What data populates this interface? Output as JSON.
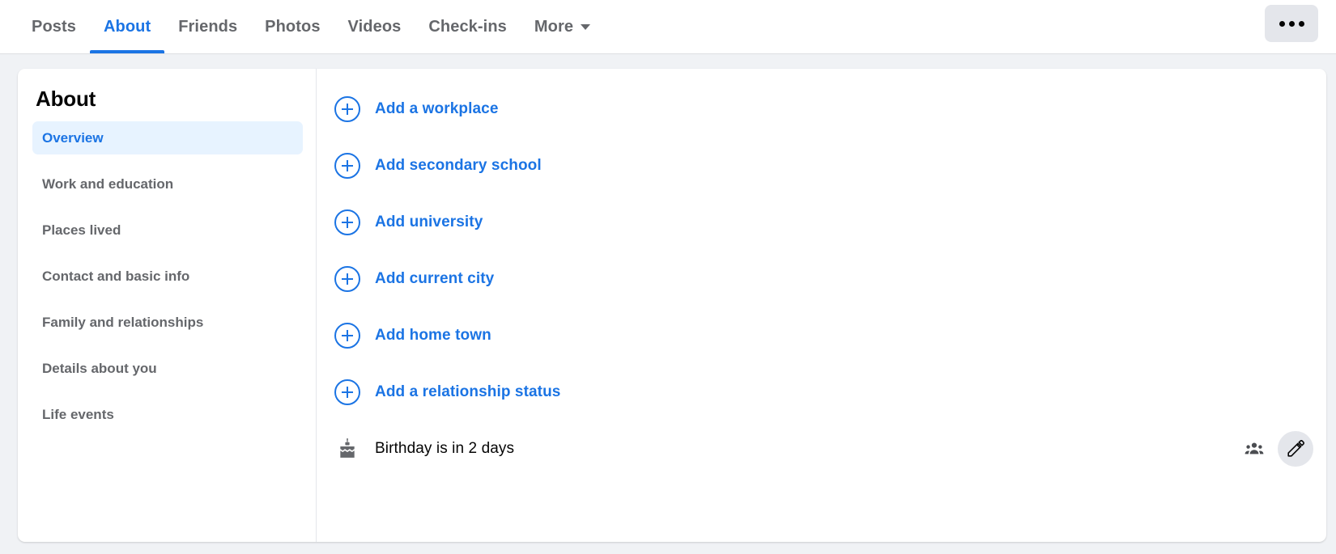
{
  "tabbar": {
    "tabs": [
      {
        "label": "Posts",
        "active": false,
        "caret": false
      },
      {
        "label": "About",
        "active": true,
        "caret": false
      },
      {
        "label": "Friends",
        "active": false,
        "caret": false
      },
      {
        "label": "Photos",
        "active": false,
        "caret": false
      },
      {
        "label": "Videos",
        "active": false,
        "caret": false
      },
      {
        "label": "Check-ins",
        "active": false,
        "caret": false
      },
      {
        "label": "More",
        "active": false,
        "caret": true
      }
    ],
    "more_options_button": "more-options-icon"
  },
  "sidebar": {
    "title": "About",
    "items": [
      {
        "label": "Overview",
        "active": true
      },
      {
        "label": "Work and education",
        "active": false
      },
      {
        "label": "Places lived",
        "active": false
      },
      {
        "label": "Contact and basic info",
        "active": false
      },
      {
        "label": "Family and relationships",
        "active": false
      },
      {
        "label": "Details about you",
        "active": false
      },
      {
        "label": "Life events",
        "active": false
      }
    ]
  },
  "main": {
    "add_rows": [
      {
        "label": "Add a workplace",
        "icon": "plus-circle-icon"
      },
      {
        "label": "Add secondary school",
        "icon": "plus-circle-icon"
      },
      {
        "label": "Add university",
        "icon": "plus-circle-icon"
      },
      {
        "label": "Add current city",
        "icon": "plus-circle-icon"
      },
      {
        "label": "Add home town",
        "icon": "plus-circle-icon"
      },
      {
        "label": "Add a relationship status",
        "icon": "plus-circle-icon"
      }
    ],
    "birthday": {
      "icon": "birthday-cake-icon",
      "label": "Birthday is in 2 days",
      "audience_icon": "friends-audience-icon",
      "edit_icon": "pencil-edit-icon"
    }
  },
  "colors": {
    "accent": "#1b74e4",
    "accent_soft": "#e7f3ff",
    "text_primary": "#050505",
    "text_secondary": "#65676b",
    "surface": "#ffffff",
    "background": "#f0f2f5",
    "control": "#e4e6eb"
  }
}
